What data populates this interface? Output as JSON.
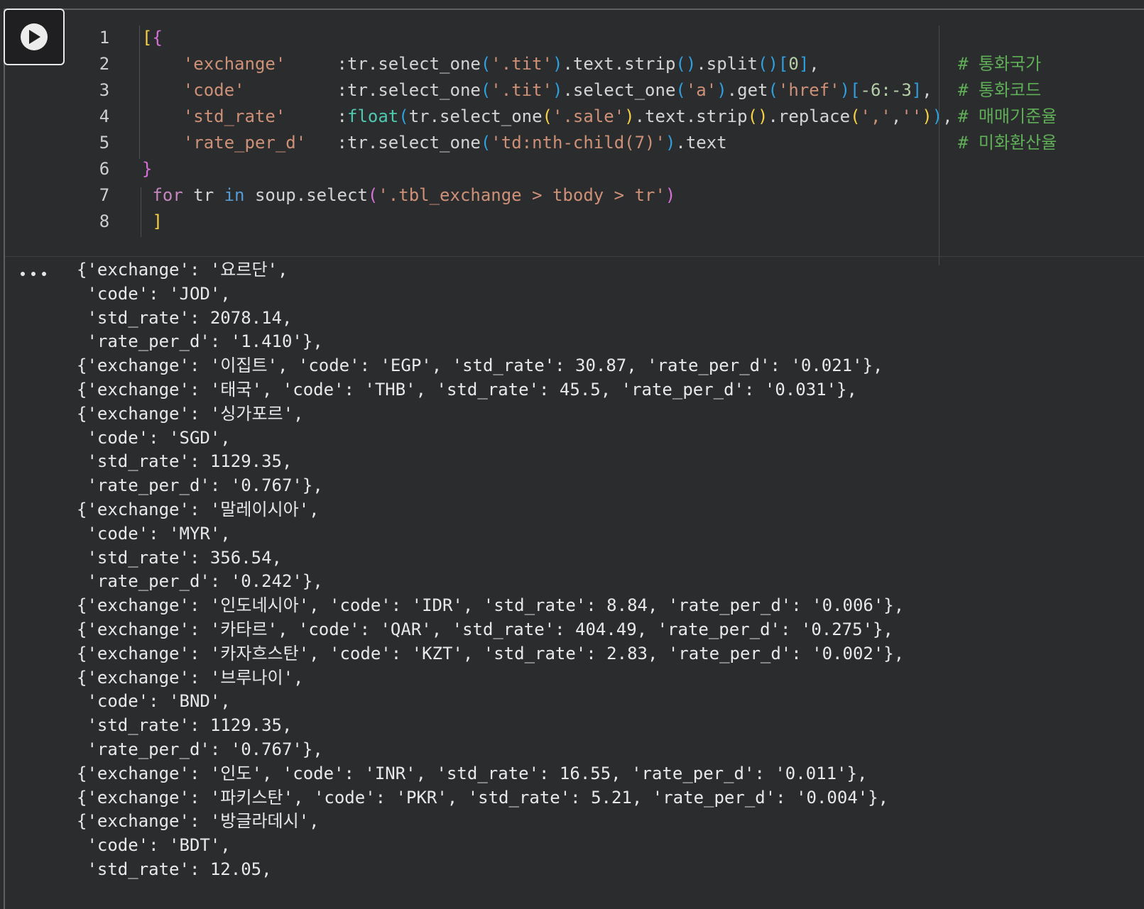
{
  "code": {
    "lines": [
      {
        "n": "1",
        "parts": [
          {
            "t": "[",
            "c": "br1"
          },
          {
            "t": "{",
            "c": "br2"
          }
        ]
      },
      {
        "n": "2",
        "parts": [
          {
            "t": "    'exchange'     ",
            "c": "str"
          },
          {
            "t": ":tr.select_one",
            "c": ""
          },
          {
            "t": "(",
            "c": "br3"
          },
          {
            "t": "'.tit'",
            "c": "str"
          },
          {
            "t": ")",
            "c": "br3"
          },
          {
            "t": ".text.strip",
            "c": ""
          },
          {
            "t": "()",
            "c": "br3"
          },
          {
            "t": ".split",
            "c": ""
          },
          {
            "t": "()",
            "c": "br3"
          },
          {
            "t": "[",
            "c": "br3"
          },
          {
            "t": "0",
            "c": "num"
          },
          {
            "t": "]",
            "c": "br3"
          },
          {
            "t": ",",
            "c": ""
          }
        ]
      },
      {
        "n": "3",
        "parts": [
          {
            "t": "    'code'         ",
            "c": "str"
          },
          {
            "t": ":tr.select_one",
            "c": ""
          },
          {
            "t": "(",
            "c": "br3"
          },
          {
            "t": "'.tit'",
            "c": "str"
          },
          {
            "t": ")",
            "c": "br3"
          },
          {
            "t": ".select_one",
            "c": ""
          },
          {
            "t": "(",
            "c": "br3"
          },
          {
            "t": "'a'",
            "c": "str"
          },
          {
            "t": ")",
            "c": "br3"
          },
          {
            "t": ".get",
            "c": ""
          },
          {
            "t": "(",
            "c": "br3"
          },
          {
            "t": "'href'",
            "c": "str"
          },
          {
            "t": ")",
            "c": "br3"
          },
          {
            "t": "[",
            "c": "br3"
          },
          {
            "t": "-6:-3",
            "c": "num"
          },
          {
            "t": "]",
            "c": "br3"
          },
          {
            "t": ",",
            "c": ""
          }
        ]
      },
      {
        "n": "4",
        "parts": [
          {
            "t": "    'std_rate'     ",
            "c": "str"
          },
          {
            "t": ":",
            "c": ""
          },
          {
            "t": "float",
            "c": "fn"
          },
          {
            "t": "(",
            "c": "br3"
          },
          {
            "t": "tr.select_one",
            "c": ""
          },
          {
            "t": "(",
            "c": "br1"
          },
          {
            "t": "'.sale'",
            "c": "str"
          },
          {
            "t": ")",
            "c": "br1"
          },
          {
            "t": ".text.strip",
            "c": ""
          },
          {
            "t": "()",
            "c": "br1"
          },
          {
            "t": ".replace",
            "c": ""
          },
          {
            "t": "(",
            "c": "br1"
          },
          {
            "t": "','",
            "c": "str"
          },
          {
            "t": ",",
            "c": ""
          },
          {
            "t": "''",
            "c": "str"
          },
          {
            "t": ")",
            "c": "br1"
          },
          {
            "t": ")",
            "c": "br3"
          },
          {
            "t": ",",
            "c": ""
          }
        ]
      },
      {
        "n": "5",
        "parts": [
          {
            "t": "    'rate_per_d'   ",
            "c": "str"
          },
          {
            "t": ":tr.select_one",
            "c": ""
          },
          {
            "t": "(",
            "c": "br3"
          },
          {
            "t": "'td:nth-child(7)'",
            "c": "str"
          },
          {
            "t": ")",
            "c": "br3"
          },
          {
            "t": ".text",
            "c": ""
          }
        ]
      },
      {
        "n": "6",
        "parts": [
          {
            "t": "}",
            "c": "br2"
          }
        ]
      },
      {
        "n": "7",
        "parts": [
          {
            "t": " for",
            "c": "kw2"
          },
          {
            "t": " tr ",
            "c": ""
          },
          {
            "t": "in",
            "c": "kw"
          },
          {
            "t": " soup.select",
            "c": ""
          },
          {
            "t": "(",
            "c": "br2"
          },
          {
            "t": "'.tbl_exchange > tbody > tr'",
            "c": "str"
          },
          {
            "t": ")",
            "c": "br2"
          }
        ]
      },
      {
        "n": "8",
        "parts": [
          {
            "t": " ]",
            "c": "br1"
          }
        ]
      }
    ],
    "comments": [
      "# 통화국가",
      "# 통화코드",
      "# 매매기준율",
      "# 미화환산율"
    ]
  },
  "output": [
    "{'exchange': '요르단',",
    " 'code': 'JOD',",
    " 'std_rate': 2078.14,",
    " 'rate_per_d': '1.410'},",
    "{'exchange': '이집트', 'code': 'EGP', 'std_rate': 30.87, 'rate_per_d': '0.021'},",
    "{'exchange': '태국', 'code': 'THB', 'std_rate': 45.5, 'rate_per_d': '0.031'},",
    "{'exchange': '싱가포르',",
    " 'code': 'SGD',",
    " 'std_rate': 1129.35,",
    " 'rate_per_d': '0.767'},",
    "{'exchange': '말레이시아',",
    " 'code': 'MYR',",
    " 'std_rate': 356.54,",
    " 'rate_per_d': '0.242'},",
    "{'exchange': '인도네시아', 'code': 'IDR', 'std_rate': 8.84, 'rate_per_d': '0.006'},",
    "{'exchange': '카타르', 'code': 'QAR', 'std_rate': 404.49, 'rate_per_d': '0.275'},",
    "{'exchange': '카자흐스탄', 'code': 'KZT', 'std_rate': 2.83, 'rate_per_d': '0.002'},",
    "{'exchange': '브루나이',",
    " 'code': 'BND',",
    " 'std_rate': 1129.35,",
    " 'rate_per_d': '0.767'},",
    "{'exchange': '인도', 'code': 'INR', 'std_rate': 16.55, 'rate_per_d': '0.011'},",
    "{'exchange': '파키스탄', 'code': 'PKR', 'std_rate': 5.21, 'rate_per_d': '0.004'},",
    "{'exchange': '방글라데시',",
    " 'code': 'BDT',",
    " 'std_rate': 12.05,"
  ]
}
